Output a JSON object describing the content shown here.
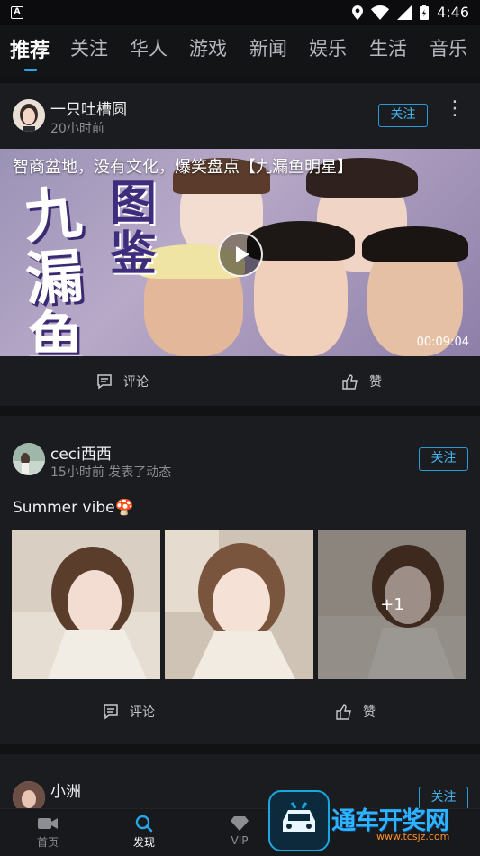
{
  "status_bar": {
    "time": "4:46"
  },
  "tabs": [
    "推荐",
    "关注",
    "华人",
    "游戏",
    "新闻",
    "娱乐",
    "生活",
    "音乐"
  ],
  "posts": [
    {
      "username": "一只吐槽圆",
      "meta": "20小时前",
      "follow_label": "关注",
      "more_label": "⋮",
      "video_title": "智商盆地，没有文化，爆笑盘点【九漏鱼明星】",
      "video_overlay_chars": [
        "九",
        "漏",
        "鱼",
        "图",
        "鉴"
      ],
      "duration": "00:09:04",
      "comment_label": "评论",
      "like_label": "赞"
    },
    {
      "username": "ceci西西",
      "meta": "15小时前  发表了动态",
      "follow_label": "关注",
      "text": "Summer vibe🍄",
      "extra_photos": "+1",
      "comment_label": "评论",
      "like_label": "赞"
    },
    {
      "username": "小洲",
      "follow_label": "关注"
    }
  ],
  "bottom_nav": [
    {
      "label": "首页",
      "icon": "video-camera-icon"
    },
    {
      "label": "发现",
      "icon": "search-icon"
    },
    {
      "label": "VIP",
      "icon": "diamond-icon"
    }
  ],
  "watermark": {
    "text": "通车开奖网",
    "sub": "www.tcsjz.com"
  },
  "colors": {
    "accent": "#27a6e6",
    "background": "#111214",
    "card": "#1b1c1f"
  }
}
